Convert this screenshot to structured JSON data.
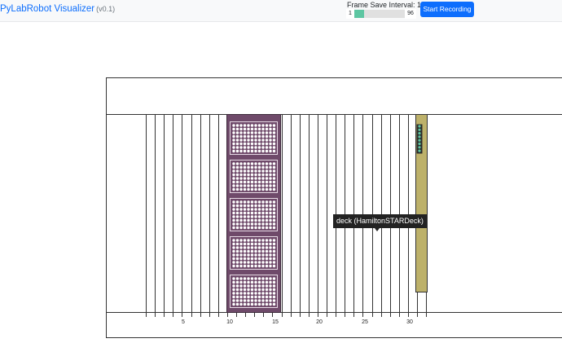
{
  "navbar": {
    "title": "PyLabRobot Visualizer",
    "version": "(v0.1)",
    "frame_save_label": "Frame Save Interval: 1",
    "slider": {
      "min_label": "1",
      "max_label": "96",
      "value": 1,
      "min": 1,
      "max": 96,
      "color": "#5dc6a2"
    },
    "record_button": "Start Recording"
  },
  "deck": {
    "tooltip": "deck (HamiltonSTARDeck)",
    "rail_labels": [
      "5",
      "10",
      "15",
      "20",
      "25",
      "30"
    ],
    "plate_carrier_color": "#6f4a6a",
    "plate_count": 5,
    "tip_carrier_color": "#bdb16a",
    "tip_color": "#5dc6a2"
  }
}
